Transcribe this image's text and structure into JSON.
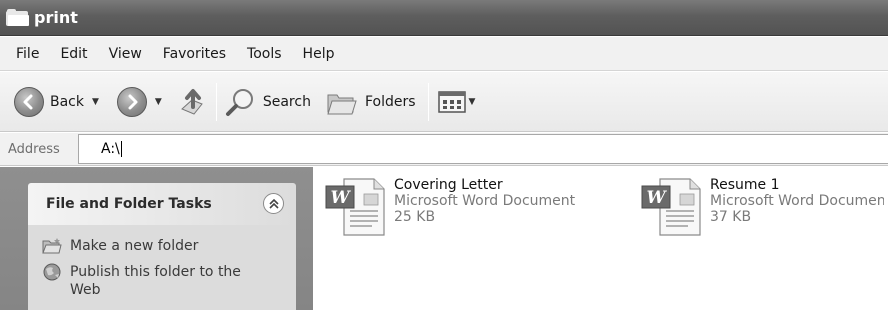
{
  "window": {
    "title": "print"
  },
  "menubar": {
    "items": [
      "File",
      "Edit",
      "View",
      "Favorites",
      "Tools",
      "Help"
    ]
  },
  "toolbar": {
    "back_label": "Back",
    "search_label": "Search",
    "folders_label": "Folders"
  },
  "address": {
    "label": "Address",
    "value": "A:\\"
  },
  "task_pane": {
    "title": "File and Folder Tasks",
    "items": [
      {
        "label": "Make a new folder",
        "icon": "new-folder-icon"
      },
      {
        "label": "Publish this folder to the Web",
        "icon": "globe-icon"
      }
    ]
  },
  "files": [
    {
      "name": "Covering Letter",
      "type": "Microsoft Word Document",
      "size": "25 KB",
      "icon": "word-document-icon"
    },
    {
      "name": "Resume 1",
      "type": "Microsoft Word Document",
      "size": "37 KB",
      "icon": "word-document-icon"
    }
  ]
}
